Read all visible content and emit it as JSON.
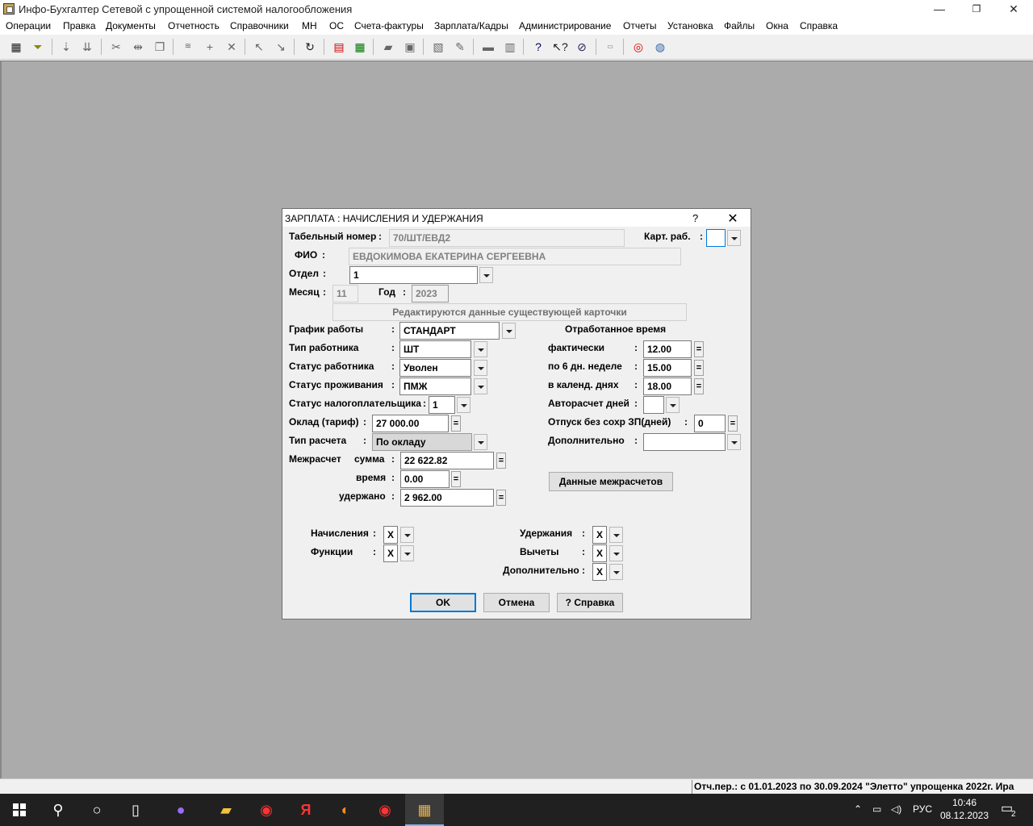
{
  "window": {
    "title": "Инфо-Бухгалтер Сетевой с упрощенной системой налогообложения",
    "minimize": "—",
    "maximize": "❐",
    "close": "✕"
  },
  "menu": [
    "Операции",
    "Правка",
    "Документы",
    "Отчетность",
    "Справочники",
    "МН",
    "ОС",
    "Счета-фактуры",
    "Зарплата/Кадры",
    "Администрирование",
    "Отчеты",
    "Установка",
    "Файлы",
    "Окна",
    "Справка"
  ],
  "dialog": {
    "title": "ЗАРПЛАТА : НАЧИСЛЕНИЯ И УДЕРЖАНИЯ",
    "help": "?",
    "close": "✕",
    "tab_number_label": "Табельный номер",
    "tab_number": "70/ШТ/ЕВД2",
    "kart_label": "Карт. раб.",
    "fio_label": "ФИО",
    "fio": "ЕВДОКИМОВА ЕКАТЕРИНА СЕРГЕЕВНА",
    "otdel_label": "Отдел",
    "otdel": "1",
    "month_label": "Месяц",
    "month": "11",
    "year_label": "Год",
    "year": "2023",
    "banner": "Редактируются данные существующей карточки",
    "schedule_label": "График работы",
    "schedule": "СТАНДАРТ",
    "worker_type_label": "Тип работника",
    "worker_type": "ШТ",
    "worker_status_label": "Статус работника",
    "worker_status": "Уволен",
    "residence_label": "Статус проживания",
    "residence": "ПМЖ",
    "taxpayer_label": "Статус налогоплательщика",
    "taxpayer": "1",
    "salary_label": "Оклад (тариф)",
    "salary": "27 000.00",
    "calc_type_label": "Тип расчета",
    "calc_type": "По окладу",
    "mezh_label": "Межрасчет",
    "mezh_sum_label": "сумма",
    "mezh_sum": "22 622.82",
    "mezh_time_label": "время",
    "mezh_time": "0.00",
    "mezh_held_label": "удержано",
    "mezh_held": "2 962.00",
    "worked_title": "Отработанное время",
    "actual_label": "фактически",
    "actual": "12.00",
    "six_day_label": "по 6 дн. неделе",
    "six_day": "15.00",
    "calendar_label": "в календ. днях",
    "calendar": "18.00",
    "autocalc_label": "Авторасчет дней",
    "unpaid_leave_label": "Отпуск без сохр ЗП(дней)",
    "unpaid_leave": "0",
    "additional_label": "Дополнительно",
    "mezh_data_btn": "Данные межрасчетов",
    "accruals_label": "Начисления",
    "accruals": "X",
    "functions_label": "Функции",
    "functions": "X",
    "deductions_label": "Удержания",
    "deductions": "X",
    "vychety_label": "Вычеты",
    "vychety": "X",
    "additional2_label": "Дополнительно",
    "additional2": "X",
    "colon": ":",
    "eq": "=",
    "ok": "OK",
    "cancel": "Отмена",
    "help_btn": "? Справка"
  },
  "status": "Отч.пер.: с 01.01.2023 по 30.09.2024 \"Элетто\" упрощенка 2022г. Ира",
  "taskbar": {
    "lang": "РУС",
    "time": "10:46",
    "date": "08.12.2023",
    "notifications": "2"
  }
}
